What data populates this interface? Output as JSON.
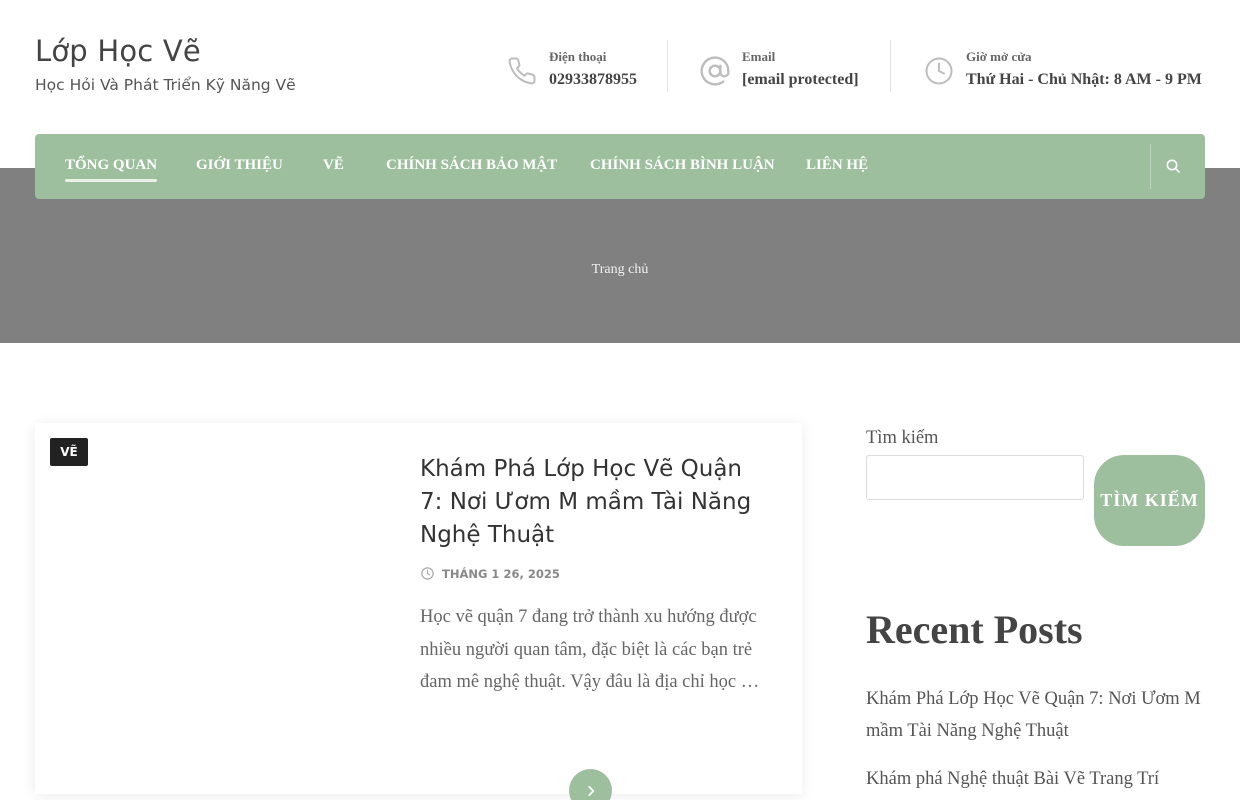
{
  "site": {
    "title": "Lớp Học Vẽ",
    "tagline": "Học Hỏi Và Phát Triển Kỹ Năng Vẽ"
  },
  "contacts": {
    "phone": {
      "label": "Điện thoại",
      "value": "02933878955",
      "icon": "phone-icon"
    },
    "email": {
      "label": "Email",
      "value": "[email protected]",
      "icon": "at-sign-icon"
    },
    "hours": {
      "label": "Giờ mở cửa",
      "value": "Thứ Hai - Chủ Nhật: 8 AM - 9 PM",
      "icon": "clock-icon"
    }
  },
  "nav": {
    "items": [
      {
        "label": "TỔNG QUAN",
        "active": true
      },
      {
        "label": "GIỚI THIỆU"
      },
      {
        "label": "VẼ"
      },
      {
        "label": "CHÍNH SÁCH BẢO MẬT"
      },
      {
        "label": "CHÍNH SÁCH BÌNH LUẬN"
      },
      {
        "label": "LIÊN HỆ"
      }
    ],
    "search_icon": "search-icon"
  },
  "breadcrumb": "Trang chủ",
  "post": {
    "category": "VẼ",
    "title": "Khám Phá Lớp Học Vẽ Quận 7: Nơi Ươm M mầm Tài Năng Nghệ Thuật",
    "date": "THÁNG 1 26, 2025",
    "excerpt": "Học vẽ quận 7 đang trở thành xu hướng được nhiều người quan tâm, đặc biệt là các bạn trẻ đam mê nghệ thuật. Vậy đâu là địa chỉ học …",
    "read_more_icon": "chevron-right-icon"
  },
  "sidebar": {
    "search_label": "Tìm kiếm",
    "search_value": "",
    "search_button": "TÌM KIẾM",
    "recent_title": "Recent Posts",
    "recent_posts": [
      "Khám Phá Lớp Học Vẽ Quận 7: Nơi Ươm M mầm Tài Năng Nghệ Thuật",
      "Khám phá Nghệ thuật Bài Vẽ Trang Trí"
    ]
  },
  "colors": {
    "accent": "#9dbf9e",
    "hero": "#808080",
    "text": "#444444"
  }
}
